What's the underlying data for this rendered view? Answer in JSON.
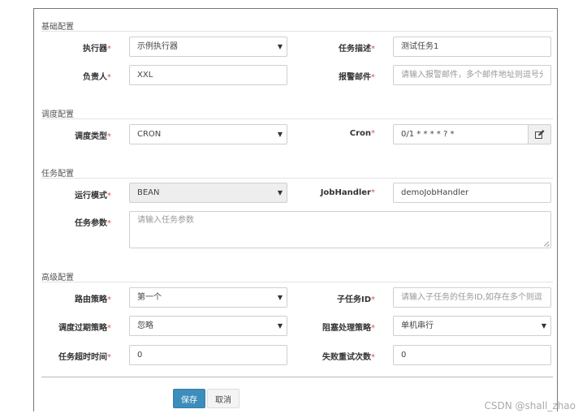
{
  "sections": {
    "basic": "基础配置",
    "schedule": "调度配置",
    "task": "任务配置",
    "advanced": "高级配置"
  },
  "required_mark": "*",
  "fields": {
    "executor": {
      "label": "执行器",
      "value": "示例执行器"
    },
    "job_desc": {
      "label": "任务描述",
      "value": "测试任务1"
    },
    "author": {
      "label": "负责人",
      "value": "XXL"
    },
    "alarm_email": {
      "label": "报警邮件",
      "placeholder": "请输入报警邮件，多个邮件地址则逗号分隔"
    },
    "schedule_type": {
      "label": "调度类型",
      "value": "CRON"
    },
    "cron": {
      "label": "Cron",
      "value": "0/1 * * * * ? *"
    },
    "run_mode": {
      "label": "运行模式",
      "value": "BEAN"
    },
    "job_handler": {
      "label": "JobHandler",
      "value": "demoJobHandler"
    },
    "job_param": {
      "label": "任务参数",
      "placeholder": "请输入任务参数"
    },
    "route_strategy": {
      "label": "路由策略",
      "value": "第一个"
    },
    "child_job_id": {
      "label": "子任务ID",
      "placeholder": "请输入子任务的任务ID,如存在多个则逗号分隔"
    },
    "misfire_strategy": {
      "label": "调度过期策略",
      "value": "忽略"
    },
    "block_strategy": {
      "label": "阻塞处理策略",
      "value": "单机串行"
    },
    "timeout": {
      "label": "任务超时时间",
      "value": "0"
    },
    "fail_retry": {
      "label": "失败重试次数",
      "value": "0"
    }
  },
  "buttons": {
    "save": "保存",
    "cancel": "取消"
  },
  "watermark": "CSDN @shall_zhao",
  "colors": {
    "primary": "#3c8dbc",
    "required": "#d9534f"
  }
}
